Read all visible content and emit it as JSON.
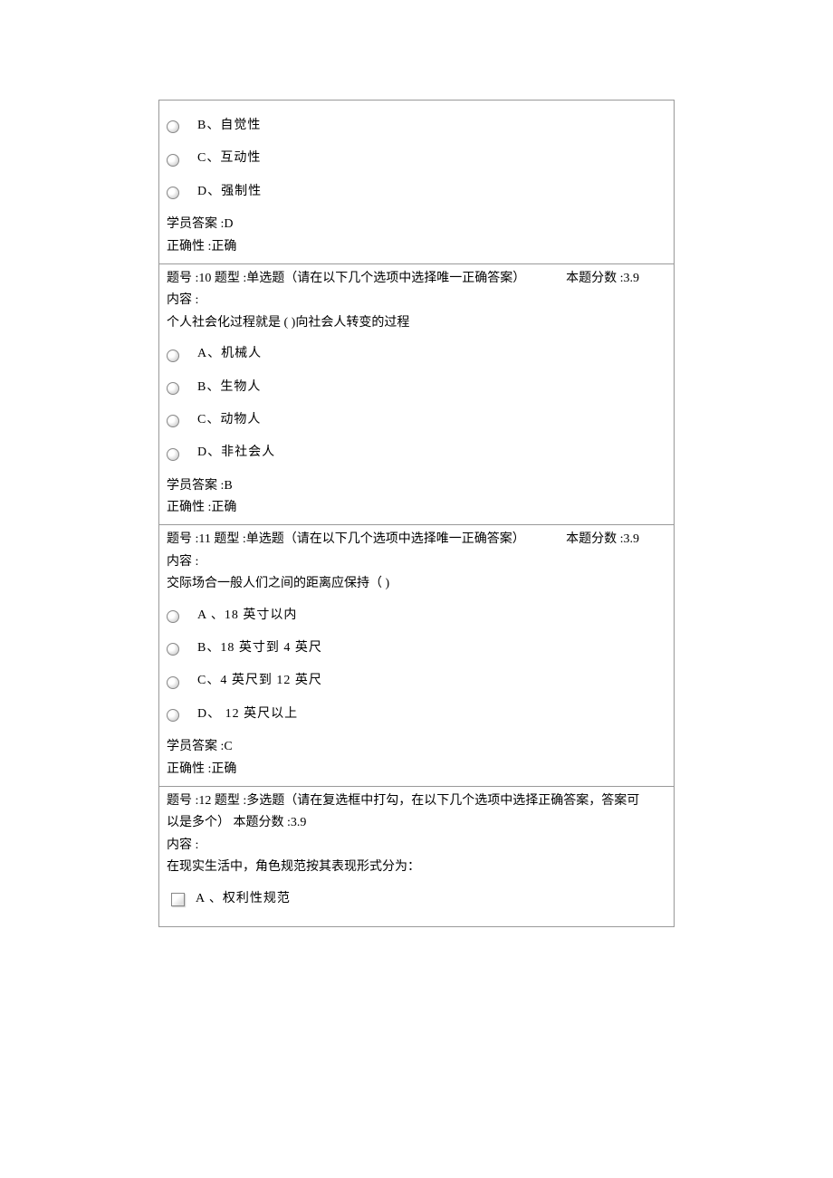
{
  "q9partial": {
    "options": [
      {
        "label": "B、自觉性"
      },
      {
        "label": "C、互动性"
      },
      {
        "label": "D、强制性"
      }
    ],
    "student_answer": "学员答案  :D",
    "correctness": "正确性 :正确"
  },
  "q10": {
    "header_left": "题号 :10  题型 :单选题（请在以下几个选项中选择唯一正确答案）",
    "score": "本题分数  :3.9",
    "content_label": "内容 :",
    "question": "个人社会化过程就是    ( )向社会人转变的过程",
    "options": [
      {
        "label": "A、机械人"
      },
      {
        "label": "B、生物人"
      },
      {
        "label": "C、动物人"
      },
      {
        "label": "D、非社会人"
      }
    ],
    "student_answer": "学员答案  :B",
    "correctness": "正确性 :正确"
  },
  "q11": {
    "header_left": "题号 :11  题型 :单选题（请在以下几个选项中选择唯一正确答案）",
    "score": "本题分数  :3.9",
    "content_label": "内容 :",
    "question": "交际场合一般人们之间的距离应保持（        )",
    "options": [
      {
        "label": "A 、18 英寸以内"
      },
      {
        "label": "B、18 英寸到   4 英尺"
      },
      {
        "label": "C、4 英尺到  12 英尺"
      },
      {
        "label": "D、 12 英尺以上"
      }
    ],
    "student_answer": "学员答案  :C",
    "correctness": "正确性 :正确"
  },
  "q12": {
    "header_line1": "题号 :12  题型 :多选题（请在复选框中打勾，在以下几个选项中选择正确答案，答案可",
    "header_line2": "以是多个）    本题分数  :3.9",
    "content_label": "内容 :",
    "question": "在现实生活中，角色规范按其表现形式分为：",
    "options": [
      {
        "label": "A 、权利性规范"
      }
    ]
  }
}
